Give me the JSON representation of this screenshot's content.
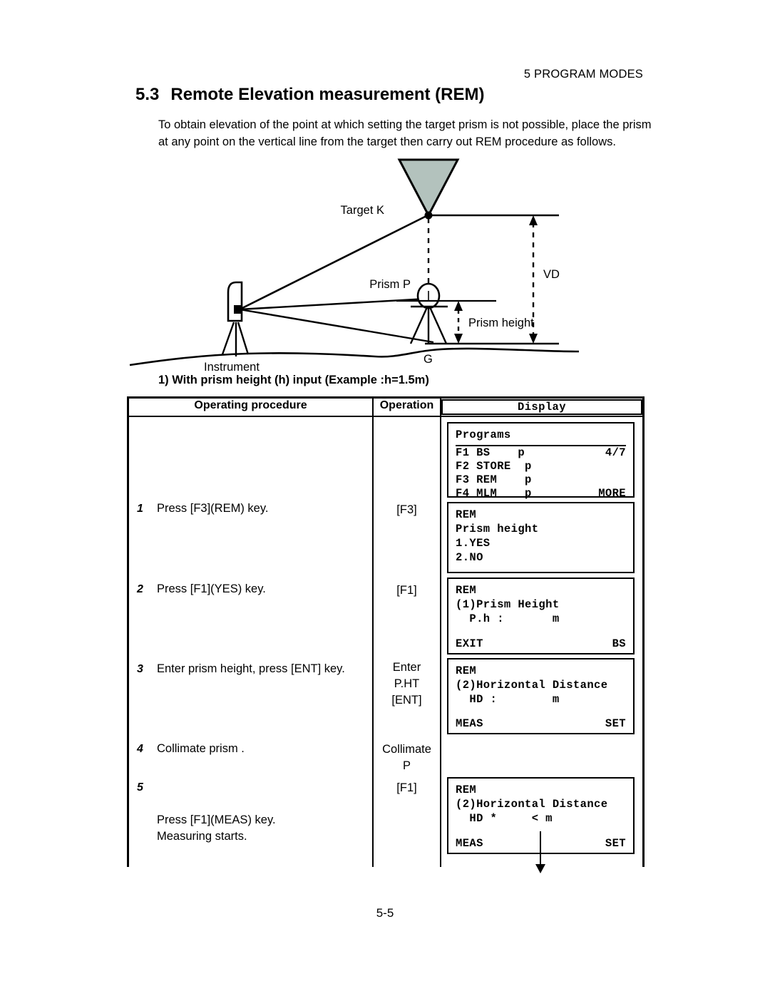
{
  "running_head": "5 PROGRAM MODES",
  "heading": {
    "number": "5.3",
    "title": "Remote Elevation measurement (REM)"
  },
  "intro": "To obtain elevation of the point at which setting the target prism is not possible, place the prism at any point on the vertical line from the target then carry out REM procedure as follows.",
  "figure": {
    "labels": {
      "target": "Target K",
      "prism": "Prism  P",
      "prism_height": "Prism height",
      "vd": "VD",
      "instrument": "Instrument",
      "ground_point": "G"
    },
    "colors": {
      "target_fill": "#b3c2bd",
      "line": "#000000"
    }
  },
  "subtitle": "1) With prism height (h) input (Example :h=1.5m)",
  "table": {
    "headers": {
      "procedure": "Operating procedure",
      "operation": "Operation",
      "display": "Display"
    },
    "steps": [
      {
        "num": "1",
        "text": "Press [F3](REM) key.",
        "operation": [
          "[F3]"
        ]
      },
      {
        "num": "2",
        "text": "Press [F1](YES) key.",
        "operation": [
          "[F1]"
        ]
      },
      {
        "num": "3",
        "text": "Enter prism height, press [ENT] key.",
        "operation": [
          "Enter",
          "P.HT",
          "[ENT]"
        ]
      },
      {
        "num": "4",
        "text": "Collimate prism .",
        "operation": [
          "Collimate",
          "P"
        ]
      },
      {
        "num": "5",
        "text": "Press [F1](MEAS) key.\nMeasuring starts.",
        "operation": [
          "[F1]"
        ]
      }
    ],
    "displays": [
      {
        "name": "programs-screen",
        "title": "Programs",
        "has_title_rule": true,
        "rows": [
          {
            "left": "F1 BS    p",
            "right": "4/7"
          },
          {
            "left": "F2 STORE  p",
            "right": ""
          },
          {
            "left": "F3 REM    p",
            "right": ""
          },
          {
            "left": "F4 MLM    p",
            "right": "MORE"
          }
        ]
      },
      {
        "name": "rem-prism-height-prompt",
        "title": "REM",
        "has_title_rule": false,
        "rows": [
          {
            "left": "Prism height",
            "right": ""
          },
          {
            "left": "1.YES",
            "right": ""
          },
          {
            "left": "2.NO",
            "right": ""
          }
        ]
      },
      {
        "name": "rem-prism-height-input",
        "title": "REM",
        "has_title_rule": false,
        "rows": [
          {
            "left": "(1)Prism Height",
            "right": ""
          },
          {
            "left": "  P.h :       m",
            "right": ""
          },
          {
            "left": "",
            "right": ""
          },
          {
            "left": "EXIT",
            "right": "BS"
          }
        ]
      },
      {
        "name": "rem-horizontal-distance-input",
        "title": "REM",
        "has_title_rule": false,
        "rows": [
          {
            "left": "(2)Horizontal Distance",
            "right": ""
          },
          {
            "left": "  HD :        m",
            "right": ""
          },
          {
            "left": "",
            "right": ""
          },
          {
            "left": "MEAS",
            "right": "SET"
          }
        ]
      },
      {
        "name": "rem-horizontal-distance-measuring",
        "title": "REM",
        "has_title_rule": false,
        "rows": [
          {
            "left": "(2)Horizontal Distance",
            "right": ""
          },
          {
            "left": "  HD *     < m",
            "right": ""
          },
          {
            "left": "",
            "right": ""
          },
          {
            "left": "MEAS",
            "right": "SET"
          }
        ]
      }
    ]
  },
  "folio": "5-5"
}
